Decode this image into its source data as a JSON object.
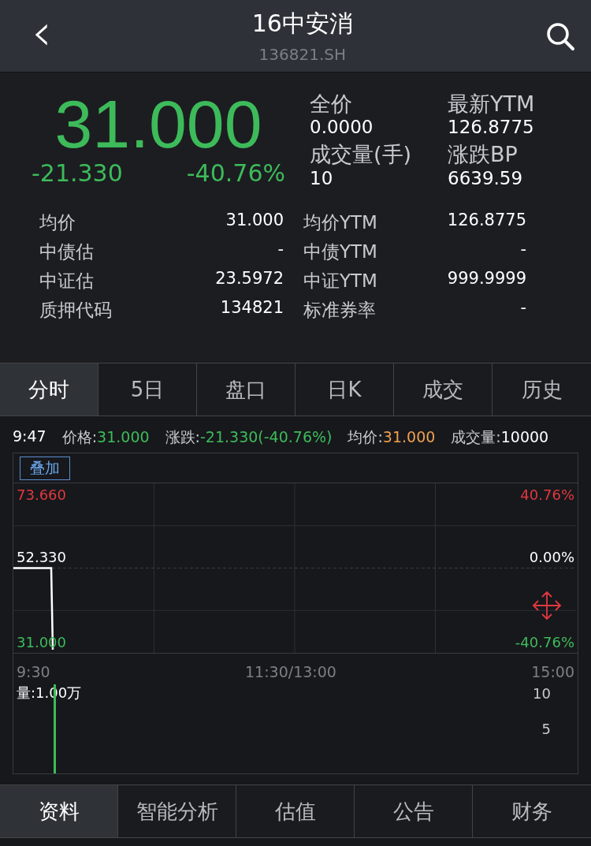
{
  "header": {
    "back": "‹",
    "title": "16中安消",
    "code": "136821.SH"
  },
  "quote": {
    "price": "31.000",
    "change": "-21.330",
    "change_pct": "-40.76%",
    "stats": [
      {
        "label": "全价",
        "value": "0.0000"
      },
      {
        "label": "最新YTM",
        "value": "126.8775"
      },
      {
        "label": "成交量(手)",
        "value": "10"
      },
      {
        "label": "涨跌BP",
        "value": "6639.59"
      }
    ],
    "details": [
      {
        "label": "均价",
        "value": "31.000"
      },
      {
        "label": "均价YTM",
        "value": "126.8775"
      },
      {
        "label": "中债估",
        "value": "-"
      },
      {
        "label": "中债YTM",
        "value": "-"
      },
      {
        "label": "中证估",
        "value": "23.5972"
      },
      {
        "label": "中证YTM",
        "value": "999.9999"
      },
      {
        "label": "质押代码",
        "value": "134821"
      },
      {
        "label": "标准券率",
        "value": "-"
      }
    ]
  },
  "tabs": [
    {
      "label": "分时",
      "selected": true
    },
    {
      "label": "5日",
      "selected": false
    },
    {
      "label": "盘口",
      "selected": false
    },
    {
      "label": "日K",
      "selected": false
    },
    {
      "label": "成交",
      "selected": false
    },
    {
      "label": "历史",
      "selected": false
    }
  ],
  "info_line": {
    "time": "9:47",
    "items": [
      {
        "label": "价格:",
        "value": "31.000",
        "color": "#3dbb5a"
      },
      {
        "label": "涨跌:",
        "value": "-21.330(-40.76%)",
        "color": "#3dbb5a"
      },
      {
        "label": "均价:",
        "value": "31.000",
        "color": "#f0a050"
      },
      {
        "label": "成交量:",
        "value": "10000",
        "color": "#ffffff"
      }
    ]
  },
  "overlay_button": "叠加",
  "price_chart": {
    "right_labels": [
      {
        "text": "40.76%",
        "color": "#e0393e"
      },
      {
        "text": "0.00%",
        "color": "#ffffff"
      },
      {
        "text": "-40.76%",
        "color": "#3dbb5a"
      }
    ],
    "time_axis": [
      "9:30",
      "11:30/13:00",
      "15:00"
    ],
    "left_labels": [
      {
        "text": "73.660",
        "color": "#e0393e"
      },
      {
        "text": "52.330",
        "color": "#ffffff"
      },
      {
        "text": "31.000",
        "color": "#3dbb5a"
      }
    ],
    "kind": "picture"
  },
  "volume_chart": {
    "label": "量:1.00万",
    "ticks": [
      "10",
      "5"
    ]
  },
  "bottom_tabs": [
    {
      "label": "资料",
      "selected": true
    },
    {
      "label": "智能分析",
      "selected": false
    },
    {
      "label": "估值",
      "selected": false
    },
    {
      "label": "公告",
      "selected": false
    },
    {
      "label": "财务",
      "selected": false
    }
  ]
}
